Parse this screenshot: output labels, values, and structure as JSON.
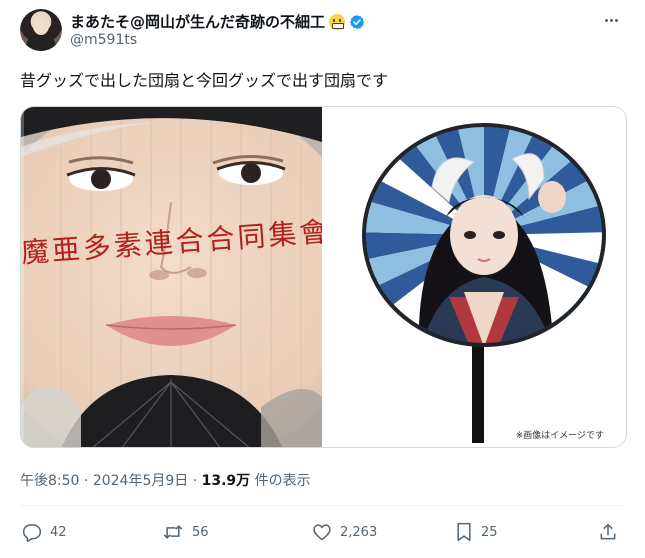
{
  "author": {
    "display_name": "まあたそ@岡山が生んだ奇跡の不細工",
    "handle": "@m591ts",
    "emoji_icon": "grimacing-face-icon",
    "verified_color": "#1d9bf0"
  },
  "tweet": {
    "text": "昔グッズで出した団扇と今回グッズで出す団扇です"
  },
  "media": {
    "left_fan_text": "魔亜多素連合合同集會",
    "right_caption": "※画像はイメージです"
  },
  "meta": {
    "time": "午後8:50",
    "separator": "·",
    "date": "2024年5月9日",
    "views_count": "13.9万",
    "views_label": "件の表示"
  },
  "actions": {
    "reply_count": "42",
    "retweet_count": "56",
    "like_count": "2,263",
    "bookmark_count": "25"
  },
  "colors": {
    "text_primary": "#0f1419",
    "text_secondary": "#536471",
    "border": "#cfd9de",
    "fan_stripe_blue": "#2f5b9a",
    "fan_stripe_light": "#8fbfe0",
    "fan_red_text": "#b3201c"
  }
}
